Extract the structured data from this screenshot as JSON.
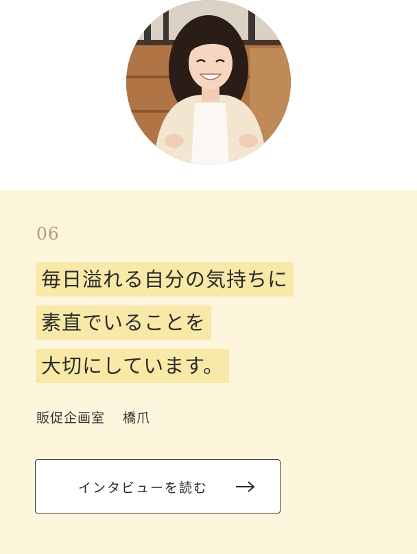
{
  "profile": {
    "photo": "portrait-photo"
  },
  "card": {
    "number": "06",
    "headline": [
      "毎日溢れる自分の気持ちに",
      "素直でいることを",
      "大切にしています。"
    ],
    "department": "販促企画室",
    "name": "橋爪",
    "button_label": "インタビューを読む",
    "button_icon": "arrow-right-icon"
  },
  "colors": {
    "card_background": "#fdf6dc",
    "highlight": "#f9e9a8",
    "number": "#b09a7c",
    "text": "#2a2a2a"
  }
}
